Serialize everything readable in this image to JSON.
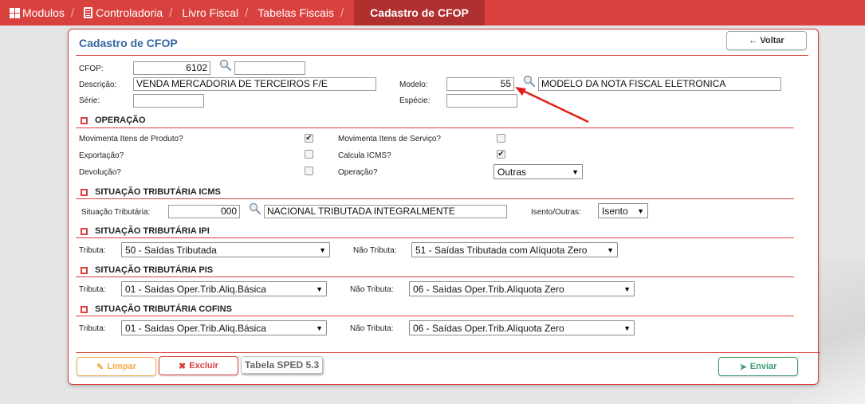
{
  "breadcrumb": {
    "items": [
      "Modulos",
      "Controladoria",
      "Livro Fiscal",
      "Tabelas Fiscais"
    ],
    "active": "Cadastro de CFOP"
  },
  "panel": {
    "title": "Cadastro de CFOP",
    "back_label": "← Voltar"
  },
  "form": {
    "cfop_label": "CFOP:",
    "cfop_value": "6102",
    "cfop_desc_value": "",
    "descricao_label": "Descrição:",
    "descricao_value": "VENDA MERCADORIA DE TERCEIROS F/E",
    "modelo_label": "Modelo:",
    "modelo_value": "55",
    "modelo_desc_value": "MODELO DA NOTA FISCAL ELETRONICA",
    "serie_label": "Série:",
    "serie_value": "",
    "especie_label": "Espécie:",
    "especie_value": ""
  },
  "operacao": {
    "title": "OPERAÇÃO",
    "movimenta_produto_label": "Movimenta Itens de Produto?",
    "movimenta_produto_checked": true,
    "movimenta_servico_label": "Movimenta Itens de Serviço?",
    "movimenta_servico_checked": false,
    "exportacao_label": "Exportação?",
    "exportacao_checked": false,
    "calcula_icms_label": "Calcula ICMS?",
    "calcula_icms_checked": true,
    "devolucao_label": "Devolução?",
    "devolucao_checked": false,
    "operacao_label": "Operação?",
    "operacao_value": "Outras"
  },
  "icms": {
    "title": "SITUAÇÃO TRIBUTÁRIA ICMS",
    "situacao_label": "Situação Tributária:",
    "situacao_code": "000",
    "situacao_desc": "NACIONAL TRIBUTADA INTEGRALMENTE",
    "isento_label": "Isento/Outras:",
    "isento_value": "Isento"
  },
  "ipi": {
    "title": "SITUAÇÃO TRIBUTÁRIA IPI",
    "tributa_label": "Tributa:",
    "tributa_value": "50 - Saídas Tributada",
    "nao_tributa_label": "Não Tributa:",
    "nao_tributa_value": "51 - Saídas Tributada com Alíquota Zero"
  },
  "pis": {
    "title": "SITUAÇÃO TRIBUTÁRIA PIS",
    "tributa_label": "Tributa:",
    "tributa_value": "01 - Saídas Oper.Trib.Aliq.Básica",
    "nao_tributa_label": "Não Tributa:",
    "nao_tributa_value": "06 - Saídas Oper.Trib.Alíquota Zero"
  },
  "cofins": {
    "title": "SITUAÇÃO TRIBUTÁRIA COFINS",
    "tributa_label": "Tributa:",
    "tributa_value": "01 - Saídas Oper.Trib.Aliq.Básica",
    "nao_tributa_label": "Não Tributa:",
    "nao_tributa_value": "06 - Saídas Oper.Trib.Alíquota Zero"
  },
  "footer": {
    "limpar_label": "Limpar",
    "excluir_label": "Excluir",
    "sped_label": "Tabela SPED 5.3",
    "enviar_label": "Enviar"
  },
  "colors": {
    "brand_red": "#d9413e",
    "active_crumb": "#b0302f",
    "title_blue": "#3465a4",
    "limpar_orange": "#f0ad4e",
    "enviar_green": "#3c9a6e"
  },
  "icons": [
    "grid-icon",
    "document-icon",
    "search-icon",
    "pencil-icon",
    "times-icon",
    "send-icon",
    "checkbox-icon"
  ]
}
